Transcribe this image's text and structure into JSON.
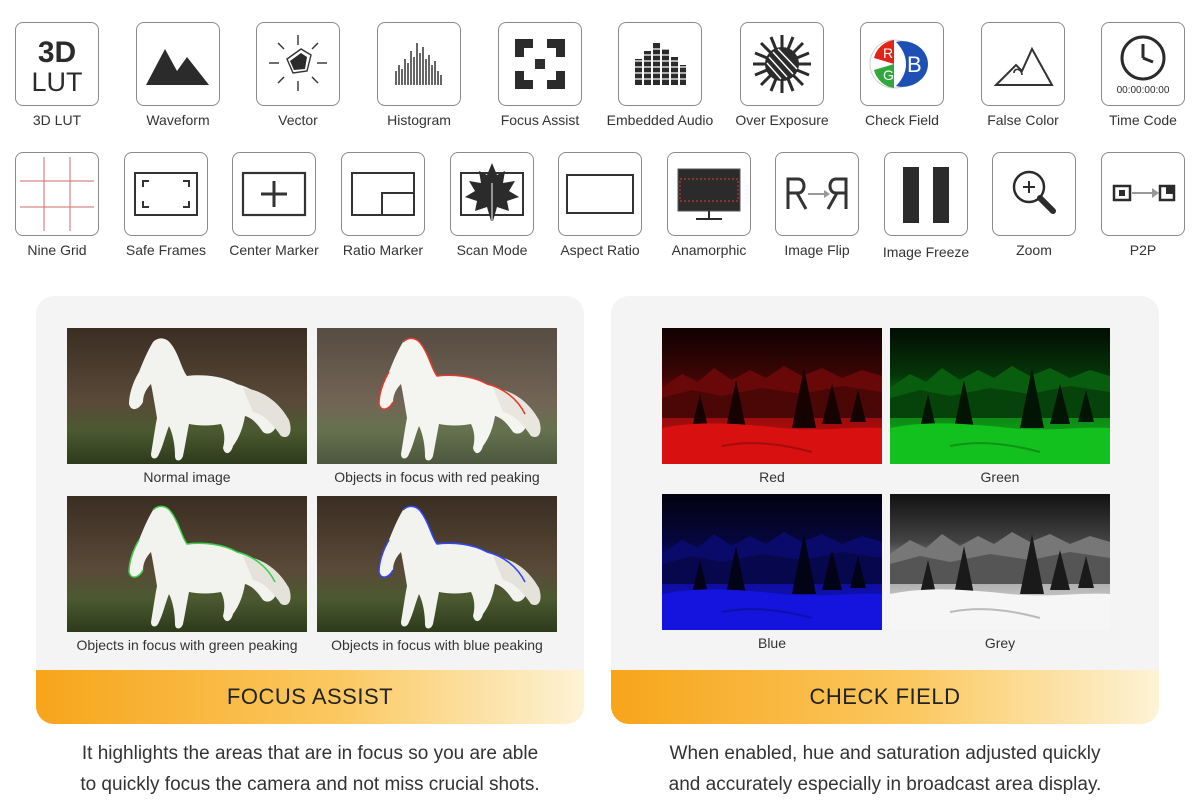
{
  "features_row1": [
    {
      "icon": "3d-lut-icon",
      "label": "3D LUT"
    },
    {
      "icon": "waveform-icon",
      "label": "Waveform"
    },
    {
      "icon": "vector-icon",
      "label": "Vector"
    },
    {
      "icon": "histogram-icon",
      "label": "Histogram"
    },
    {
      "icon": "focus-assist-icon",
      "label": "Focus Assist"
    },
    {
      "icon": "embedded-audio-icon",
      "label": "Embedded Audio"
    },
    {
      "icon": "over-exposure-icon",
      "label": "Over Exposure"
    },
    {
      "icon": "check-field-icon",
      "label": "Check Field"
    },
    {
      "icon": "false-color-icon",
      "label": "False Color"
    },
    {
      "icon": "time-code-icon",
      "label": "Time Code"
    }
  ],
  "features_row2": [
    {
      "icon": "nine-grid-icon",
      "label": "Nine Grid"
    },
    {
      "icon": "safe-frames-icon",
      "label": "Safe Frames"
    },
    {
      "icon": "center-marker-icon",
      "label": "Center Marker"
    },
    {
      "icon": "ratio-marker-icon",
      "label": "Ratio Marker"
    },
    {
      "icon": "scan-mode-icon",
      "label": "Scan Mode"
    },
    {
      "icon": "aspect-ratio-icon",
      "label": "Aspect Ratio"
    },
    {
      "icon": "anamorphic-icon",
      "label": "Anamorphic"
    },
    {
      "icon": "image-flip-icon",
      "label": "Image Flip"
    },
    {
      "icon": "image-freeze-icon",
      "label": "Image Freeze"
    },
    {
      "icon": "zoom-icon",
      "label": "Zoom"
    },
    {
      "icon": "p2p-icon",
      "label": "P2P"
    }
  ],
  "icon_text": {
    "lut_top": "3D",
    "lut_bottom": "LUT",
    "timecode": "00:00:00:00",
    "check_r": "R",
    "check_g": "G",
    "check_b": "B"
  },
  "focus_assist": {
    "title": "FOCUS ASSIST",
    "images": [
      {
        "caption": "Normal image",
        "peaking": "none"
      },
      {
        "caption": "Objects in focus with red peaking",
        "peaking": "#e53a2a"
      },
      {
        "caption": "Objects in focus with green peaking",
        "peaking": "#39d04a"
      },
      {
        "caption": "Objects in focus with blue peaking",
        "peaking": "#2f45ff"
      }
    ],
    "description_line1": "It highlights the areas that are in focus so you are able",
    "description_line2": "to quickly focus the camera and not miss crucial shots."
  },
  "check_field": {
    "title": "CHECK FIELD",
    "images": [
      {
        "caption": "Red",
        "tint": "#e01010"
      },
      {
        "caption": "Green",
        "tint": "#12c81e"
      },
      {
        "caption": "Blue",
        "tint": "#1414e6"
      },
      {
        "caption": "Grey",
        "tint": "#8c8c8c"
      }
    ],
    "description_line1": "When enabled,  hue and saturation adjusted quickly",
    "description_line2": "and accurately especially in broadcast area display."
  },
  "colors": {
    "banner_start": "#f7a51a",
    "banner_end": "#fdf3d6",
    "icon_dark": "#2b2b2b",
    "check_red": "#e2231a",
    "check_green": "#2eaa3c",
    "check_blue": "#1e4fb5"
  }
}
